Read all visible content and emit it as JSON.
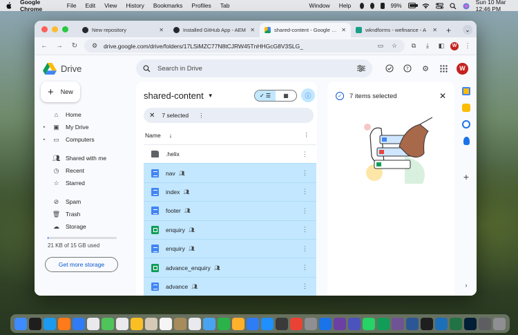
{
  "menubar": {
    "app_name": "Google Chrome",
    "items": [
      "File",
      "Edit",
      "View",
      "History",
      "Bookmarks",
      "Profiles",
      "Tab",
      "Window",
      "Help"
    ],
    "battery": "99%",
    "datetime": "Sun 10 Mar  12:46 PM"
  },
  "browser": {
    "tabs": [
      {
        "title": "New repository",
        "favicon_color": "#24292f",
        "active": false
      },
      {
        "title": "Installed GitHub App - AEM",
        "favicon_color": "#24292f",
        "active": false
      },
      {
        "title": "shared-content - Google Drive",
        "favicon_color": "#1fa463",
        "active": true
      },
      {
        "title": "wkndforms - wefinance - A",
        "favicon_color": "#1a9e8a",
        "active": false
      }
    ],
    "new_tab_symbol": "+",
    "url": "drive.google.com/drive/folders/17LSiMZC77N8tCJRW45TnHHGcG8V3SLG_",
    "profile_initial": "W"
  },
  "drive": {
    "product_name": "Drive",
    "search_placeholder": "Search in Drive",
    "avatar_initial": "W",
    "new_button_label": "New",
    "nav": [
      {
        "label": "Home",
        "icon": "home-icon",
        "caret": false
      },
      {
        "label": "My Drive",
        "icon": "drive-icon",
        "caret": true
      },
      {
        "label": "Computers",
        "icon": "computer-icon",
        "caret": true
      }
    ],
    "nav2": [
      {
        "label": "Shared with me",
        "icon": "people-icon"
      },
      {
        "label": "Recent",
        "icon": "clock-icon"
      },
      {
        "label": "Starred",
        "icon": "star-icon"
      }
    ],
    "nav3": [
      {
        "label": "Spam",
        "icon": "spam-icon"
      },
      {
        "label": "Trash",
        "icon": "trash-icon"
      },
      {
        "label": "Storage",
        "icon": "cloud-icon"
      }
    ],
    "storage_used_fraction": 0.01,
    "storage_text": "21 KB of 15 GB used",
    "get_storage_label": "Get more storage",
    "folder_title": "shared-content",
    "selection_text": "7 selected",
    "column_name": "Name",
    "files": [
      {
        "name": ".helix",
        "type": "shared-folder",
        "shared": false,
        "selected": false
      },
      {
        "name": "nav",
        "type": "doc",
        "shared": true,
        "selected": true
      },
      {
        "name": "index",
        "type": "doc",
        "shared": true,
        "selected": true
      },
      {
        "name": "footer",
        "type": "doc",
        "shared": true,
        "selected": true
      },
      {
        "name": "enquiry",
        "type": "sheet",
        "shared": true,
        "selected": true
      },
      {
        "name": "enquiry",
        "type": "doc",
        "shared": true,
        "selected": true
      },
      {
        "name": "advance_enquiry",
        "type": "sheet",
        "shared": true,
        "selected": true
      },
      {
        "name": "advance",
        "type": "doc",
        "shared": true,
        "selected": true
      }
    ],
    "details_title": "7 items selected",
    "accent_color": "#0b57d0",
    "selected_row_color": "#c2e7ff"
  }
}
